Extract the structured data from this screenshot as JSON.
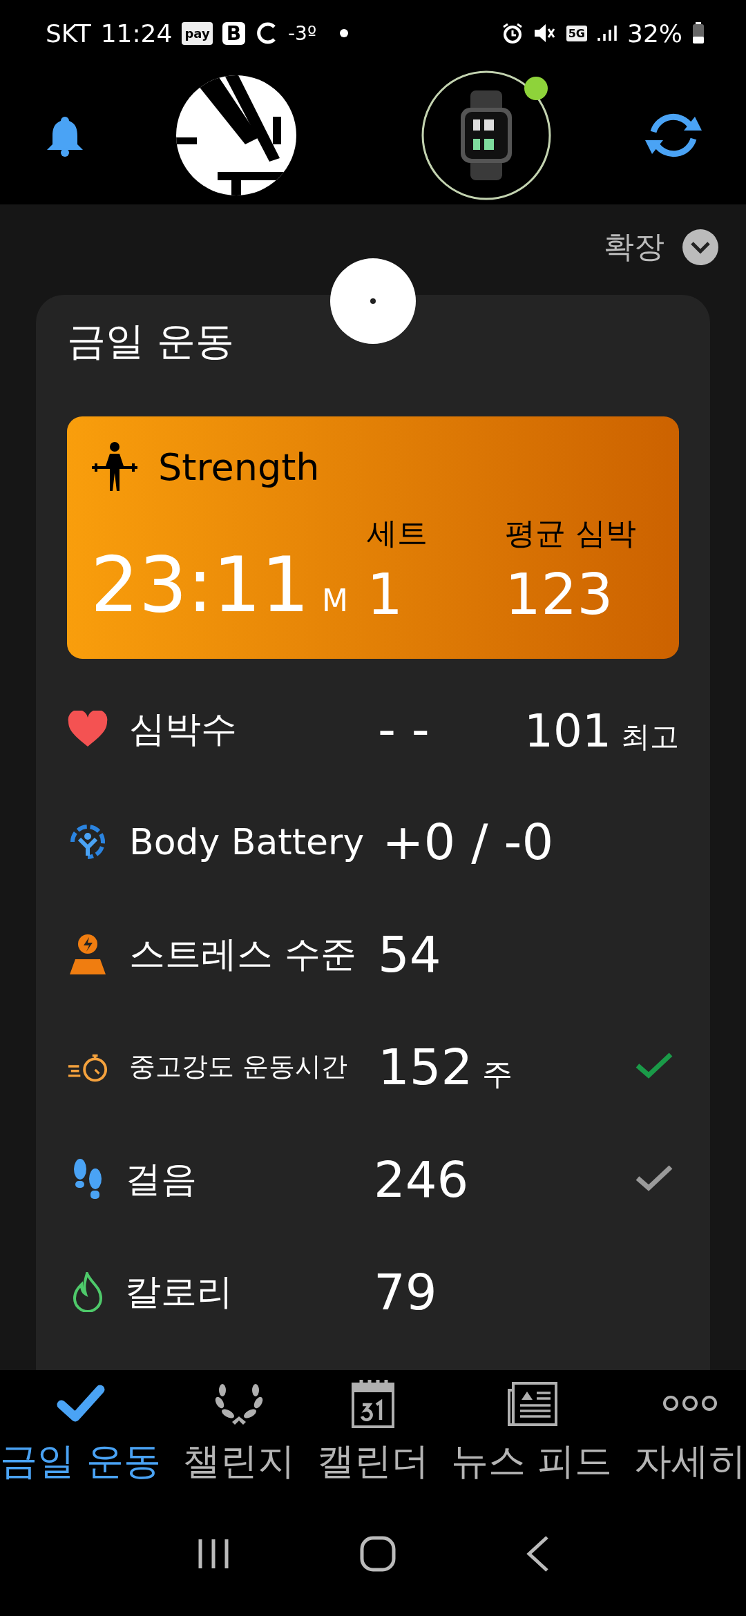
{
  "status_bar": {
    "carrier": "SKT",
    "time": "11:24",
    "pay_badge": "pay",
    "app_badge": "B",
    "temperature": "-3º",
    "network": "5G",
    "battery": "32%"
  },
  "header": {
    "device_connected": true
  },
  "expand": {
    "label": "확장",
    "expanded": false
  },
  "today": {
    "title": "금일 운동",
    "activity": {
      "name": "Strength",
      "duration": "23:11",
      "duration_unit": "M",
      "stats": [
        {
          "label": "세트",
          "value": "1"
        },
        {
          "label": "평균 심박",
          "value": "123"
        }
      ]
    },
    "metrics": [
      {
        "kind": "heart",
        "label": "심박수",
        "value": "- -",
        "extra_value": "101",
        "extra_unit": "최고"
      },
      {
        "kind": "body_battery",
        "label": "Body Battery",
        "value": "+0 / -0"
      },
      {
        "kind": "stress",
        "label": "스트레스 수준",
        "value": "54"
      },
      {
        "kind": "intensity",
        "label": "중고강도 운동시간",
        "value": "152",
        "unit": "주",
        "goal_reached": true
      },
      {
        "kind": "steps",
        "label": "걸음",
        "value": "246",
        "goal_reached": false
      },
      {
        "kind": "calories",
        "label": "칼로리",
        "value": "79"
      }
    ]
  },
  "tabs": [
    {
      "kind": "today",
      "label": "금일 운동",
      "selected": true
    },
    {
      "kind": "challenges",
      "label": "챌린지",
      "selected": false
    },
    {
      "kind": "calendar",
      "label": "캘린더",
      "selected": false
    },
    {
      "kind": "news",
      "label": "뉴스 피드",
      "selected": false
    },
    {
      "kind": "more",
      "label": "자세히",
      "selected": false
    }
  ]
}
